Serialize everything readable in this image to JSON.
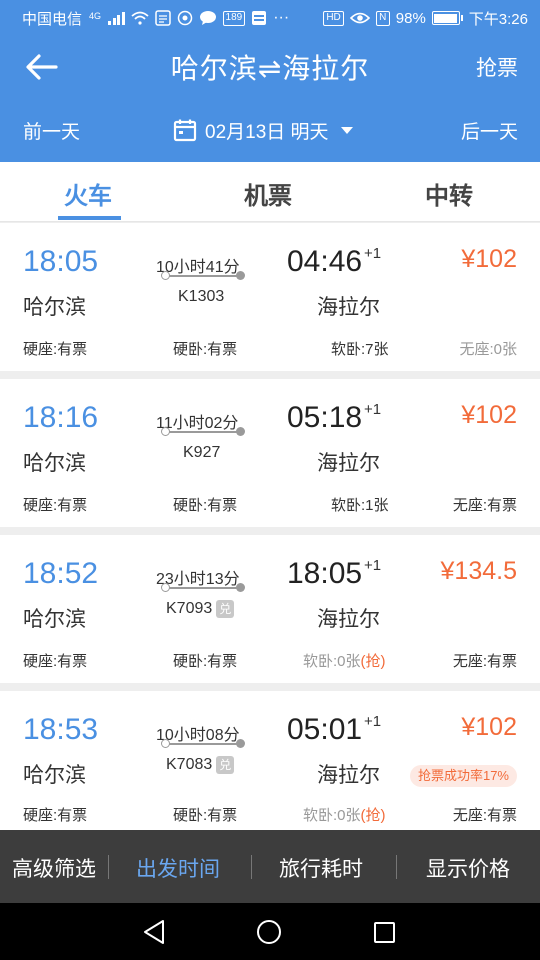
{
  "status_bar": {
    "carrier": "中国电信",
    "network": "4G",
    "badge_189": "189",
    "battery": "98%",
    "battery_level": 0.98,
    "time": "下午3:26",
    "dots": "···",
    "hd": "HD",
    "nfc": "N"
  },
  "header": {
    "title": "哈尔滨⇌海拉尔",
    "grab_label": "抢票",
    "prev_day": "前一天",
    "next_day": "后一天",
    "date": "02月13日 明天"
  },
  "tabs": [
    {
      "label": "火车",
      "active": true
    },
    {
      "label": "机票",
      "active": false
    },
    {
      "label": "中转",
      "active": false
    }
  ],
  "trains": [
    {
      "dep_time": "18:05",
      "dep_station": "哈尔滨",
      "duration": "10小时41分",
      "train_no": "K1303",
      "exchange": "",
      "arr_time": "04:46",
      "plus_day": "+1",
      "arr_station": "海拉尔",
      "price": "¥102",
      "success_rate": "",
      "seats": [
        {
          "text": "硬座:有票",
          "grab": "",
          "gray": false
        },
        {
          "text": "硬卧:有票",
          "grab": "",
          "gray": false
        },
        {
          "text": "软卧:7张",
          "grab": "",
          "gray": false
        },
        {
          "text": "无座:0张",
          "grab": "",
          "gray": true
        }
      ]
    },
    {
      "dep_time": "18:16",
      "dep_station": "哈尔滨",
      "duration": "11小时02分",
      "train_no": "K927",
      "exchange": "",
      "arr_time": "05:18",
      "plus_day": "+1",
      "arr_station": "海拉尔",
      "price": "¥102",
      "success_rate": "",
      "seats": [
        {
          "text": "硬座:有票",
          "grab": "",
          "gray": false
        },
        {
          "text": "硬卧:有票",
          "grab": "",
          "gray": false
        },
        {
          "text": "软卧:1张",
          "grab": "",
          "gray": false
        },
        {
          "text": "无座:有票",
          "grab": "",
          "gray": false
        }
      ]
    },
    {
      "dep_time": "18:52",
      "dep_station": "哈尔滨",
      "duration": "23小时13分",
      "train_no": "K7093",
      "exchange": "兑",
      "arr_time": "18:05",
      "plus_day": "+1",
      "arr_station": "海拉尔",
      "price": "¥134.5",
      "success_rate": "",
      "seats": [
        {
          "text": "硬座:有票",
          "grab": "",
          "gray": false
        },
        {
          "text": "硬卧:有票",
          "grab": "",
          "gray": false
        },
        {
          "text": "软卧:0张",
          "grab": "(抢)",
          "gray": true
        },
        {
          "text": "无座:有票",
          "grab": "",
          "gray": false
        }
      ]
    },
    {
      "dep_time": "18:53",
      "dep_station": "哈尔滨",
      "duration": "10小时08分",
      "train_no": "K7083",
      "exchange": "兑",
      "arr_time": "05:01",
      "plus_day": "+1",
      "arr_station": "海拉尔",
      "price": "¥102",
      "success_rate": "抢票成功率17%",
      "seats": [
        {
          "text": "硬座:有票",
          "grab": "",
          "gray": false
        },
        {
          "text": "硬卧:有票",
          "grab": "",
          "gray": false
        },
        {
          "text": "软卧:0张",
          "grab": "(抢)",
          "gray": true
        },
        {
          "text": "无座:有票",
          "grab": "",
          "gray": false
        }
      ]
    }
  ],
  "bottom_bar": [
    {
      "label": "高级筛选",
      "active": false
    },
    {
      "label": "出发时间",
      "active": true
    },
    {
      "label": "旅行耗时",
      "active": false
    },
    {
      "label": "显示价格",
      "active": false
    }
  ],
  "colors": {
    "primary": "#4a90e2",
    "price": "#f26b3a",
    "bottom_bar": "#3d3d3d"
  }
}
